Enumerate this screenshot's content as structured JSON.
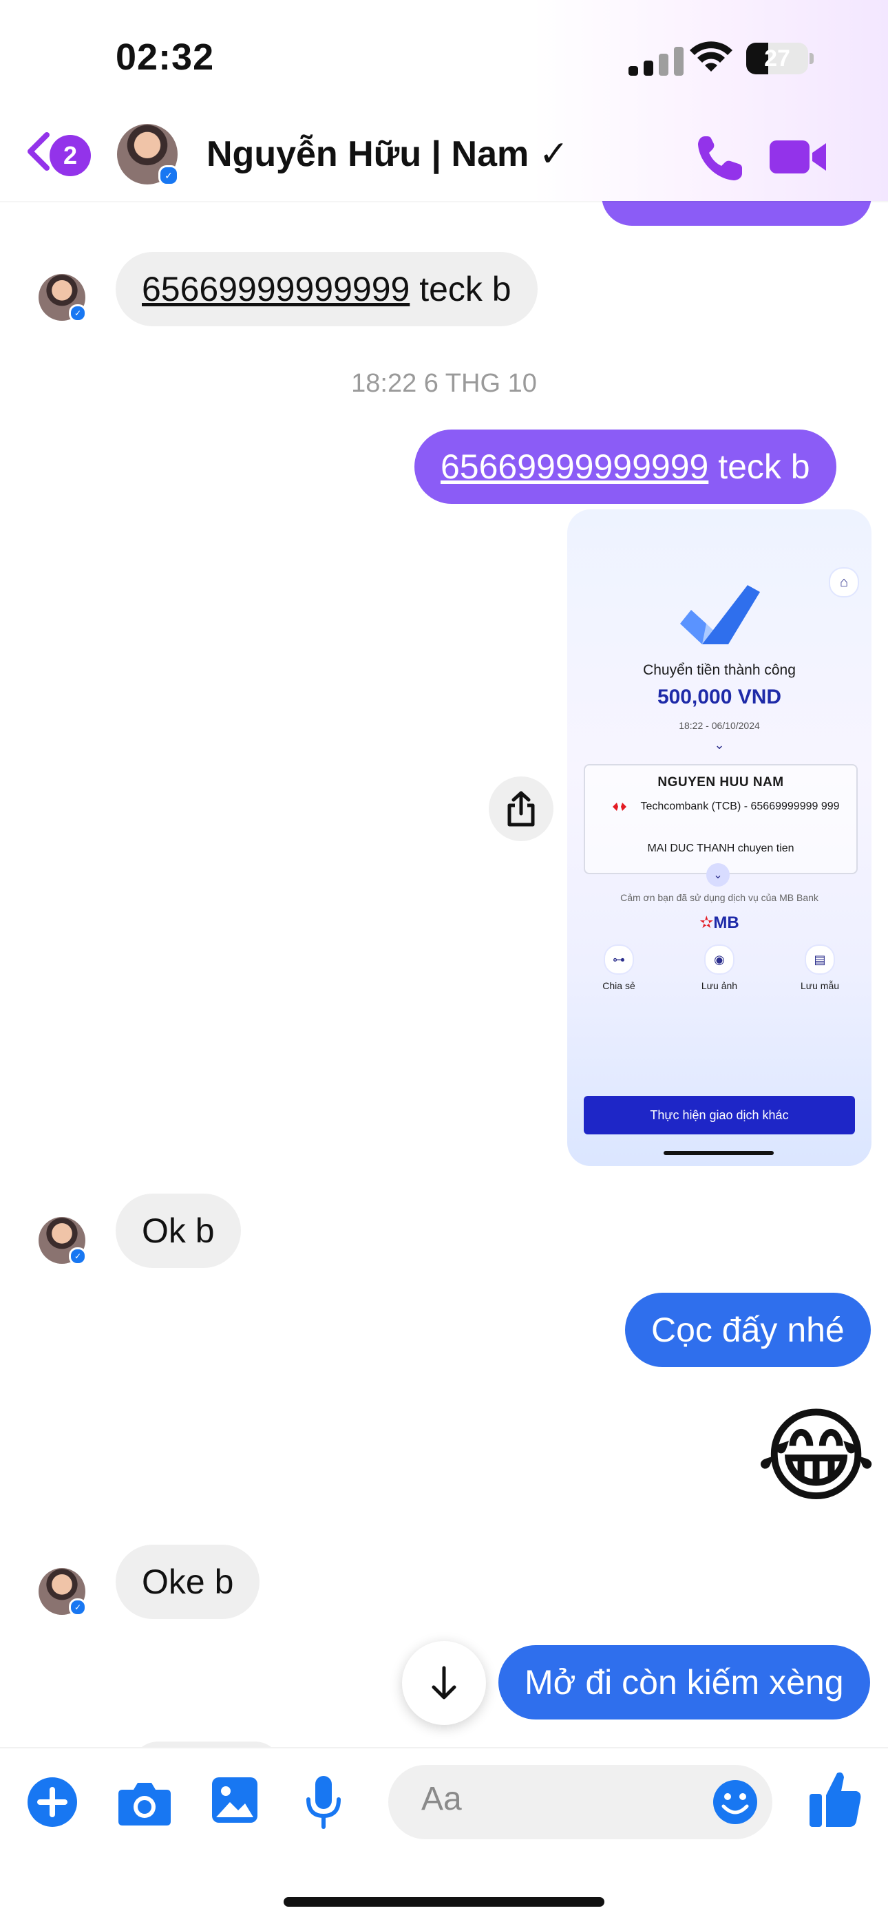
{
  "status_bar": {
    "time": "02:32",
    "battery": "27"
  },
  "header": {
    "unread_count": "2",
    "contact_name": "Nguyễn Hữu | Nam ✓"
  },
  "messages": {
    "incoming_account": {
      "number": "65669999999999",
      "suffix": " teck b"
    },
    "timestamp": "18:22 6 THG 10",
    "outgoing_account": {
      "number": "65669999999999",
      "suffix": " teck b"
    },
    "ok": "Ok b",
    "deposit": "Cọc đấy nhé",
    "emoji": "😂",
    "oke": "Oke b",
    "open": "Mở đi còn kiếm xèng"
  },
  "receipt": {
    "title": "Chuyển tiền thành công",
    "amount": "500,000 VND",
    "datetime": "18:22 - 06/10/2024",
    "recipient_name": "NGUYEN HUU NAM",
    "bank_line": "Techcombank (TCB) - 65669999999 999",
    "description": "MAI DUC THANH chuyen tien",
    "thanks": "Cảm ơn bạn đã sử dụng dịch vụ của MB Bank",
    "brand": "MB",
    "actions": [
      "Chia sẻ",
      "Lưu ảnh",
      "Lưu mẫu"
    ],
    "button": "Thực hiện giao dịch khác"
  },
  "composer": {
    "placeholder": "Aa"
  },
  "colors": {
    "accent_purple": "#8b5cf6",
    "accent_blue": "#2f6fed",
    "incoming_bg": "#efefef",
    "messenger_blue": "#1877f2"
  },
  "icons": [
    "back-chevron-icon",
    "phone-icon",
    "video-camera-icon",
    "share-icon",
    "arrow-down-icon",
    "plus-icon",
    "camera-icon",
    "gallery-icon",
    "microphone-icon",
    "emoji-smile-icon",
    "thumbs-up-icon"
  ]
}
